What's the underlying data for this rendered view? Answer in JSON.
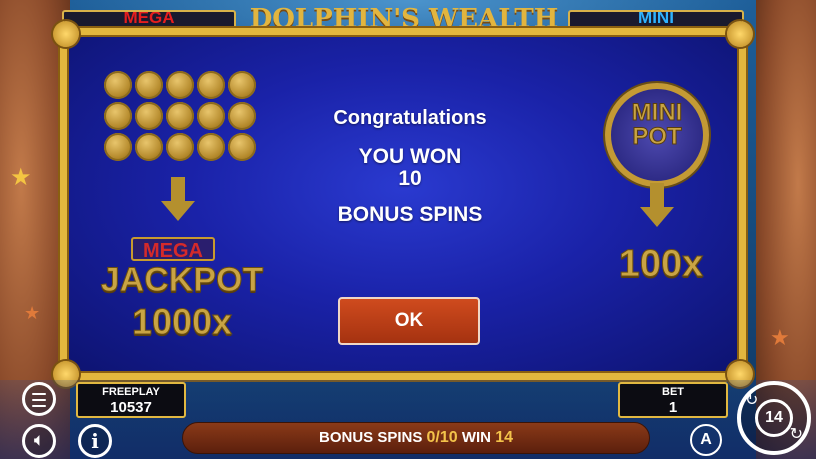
{
  "jackpots": {
    "mega_label": "MEGA",
    "mini_label": "MINI"
  },
  "game_logo": "DOLPHIN'S WEALTH",
  "popup": {
    "line1": "Congratulations",
    "line2": "YOU WON",
    "line3": "10",
    "line4": "BONUS SPINS",
    "ok_label": "OK"
  },
  "left_panel": {
    "coin_count": 15,
    "mega_label": "MEGA",
    "jackpot_label": "JACKPOT",
    "multiplier": "1000x"
  },
  "right_panel": {
    "mini_pot_line1": "MINI",
    "mini_pot_line2": "POT",
    "multiplier": "100x"
  },
  "freeplay": {
    "label": "FREEPLAY",
    "value": "10537"
  },
  "bet": {
    "label": "BET",
    "value": "1"
  },
  "status": {
    "bonus_label": "BONUS SPINS",
    "bonus_value": "0/10",
    "win_label": "WIN",
    "win_value": "14"
  },
  "controls": {
    "autoplay_glyph": "A",
    "spin_glyph": "14"
  },
  "icons": {
    "menu": "menu-icon",
    "sound": "speaker-icon",
    "info": "info-icon",
    "autoplay": "autoplay-icon",
    "spin": "spin-icon"
  },
  "colors": {
    "frame_gold": "#e3b73e",
    "popup_blue": "#1a22a8",
    "ok_button": "#c0401a",
    "highlight": "#f3c34a",
    "mega_red": "#e51e1e",
    "mini_blue": "#2fb2ff"
  }
}
